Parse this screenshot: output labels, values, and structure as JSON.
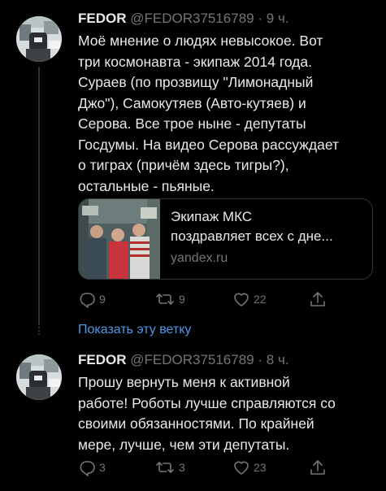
{
  "tweets": [
    {
      "name": "FEDOR",
      "handle": "@FEDOR37516789",
      "separator": "·",
      "time": "9 ч.",
      "text": "Моё мнение о людях невысокое. Вот\nтри космонавта - экипаж 2014 года.\nСураев (по прозвищу \"Лимонадный\nДжо\"), Самокутяев (Авто-кутяев) и\nСерова. Все трое ныне - депутаты\nГосдумы. На видео Серова рассуждает\nо тиграх (причём здесь тигры?),\nостальные - пьяные.",
      "card": {
        "title": "Экипаж МКС\nпоздравляет всех с дне...",
        "domain": "yandex.ru"
      },
      "actions": {
        "replies": "9",
        "retweets": "9",
        "likes": "22"
      }
    },
    {
      "name": "FEDOR",
      "handle": "@FEDOR37516789",
      "separator": "·",
      "time": "8 ч.",
      "text": "Прошу вернуть меня к активной\nработе! Роботы лучше справляются со\nсвоими обязанностями. По крайней\nмере, лучше, чем эти депутаты.",
      "actions": {
        "replies": "3",
        "retweets": "3",
        "likes": "23"
      }
    }
  ],
  "thread": {
    "show_thread_label": "Показать эту ветку"
  },
  "colors": {
    "background": "#000000",
    "text": "#e7e9ea",
    "secondary": "#71767b",
    "link": "#4a99e9",
    "border": "#2f3336"
  },
  "icons": {
    "reply": "reply-icon",
    "retweet": "retweet-icon",
    "like": "heart-icon",
    "share": "share-icon"
  }
}
